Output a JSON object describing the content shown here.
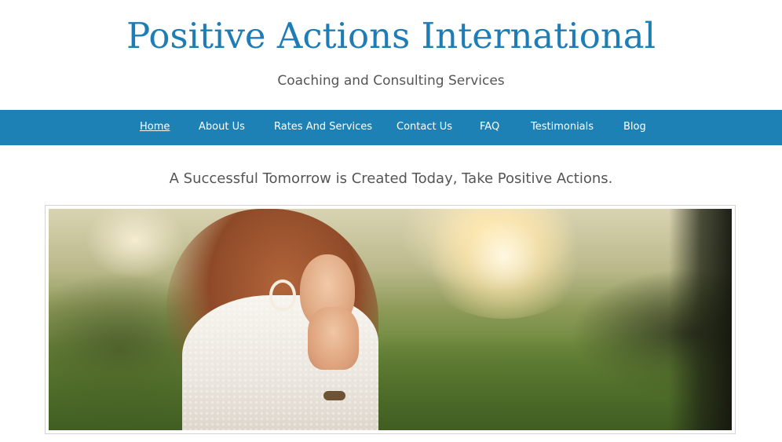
{
  "header": {
    "site_title": "Positive Actions International",
    "tagline": "Coaching and Consulting Services"
  },
  "nav": {
    "items": [
      {
        "label": "Home",
        "active": true
      },
      {
        "label": "About Us",
        "active": false
      },
      {
        "label": "Rates And Services",
        "active": false
      },
      {
        "label": "Contact Us",
        "active": false
      },
      {
        "label": "FAQ",
        "active": false
      },
      {
        "label": "Testimonials",
        "active": false
      },
      {
        "label": "Blog",
        "active": false
      }
    ]
  },
  "main": {
    "slogan": "A Successful Tomorrow is Created Today,  Take Positive Actions."
  },
  "colors": {
    "brand_blue": "#1f7db5",
    "nav_background": "#1e81b5",
    "nav_text": "#ffffff",
    "body_text": "#555555"
  }
}
